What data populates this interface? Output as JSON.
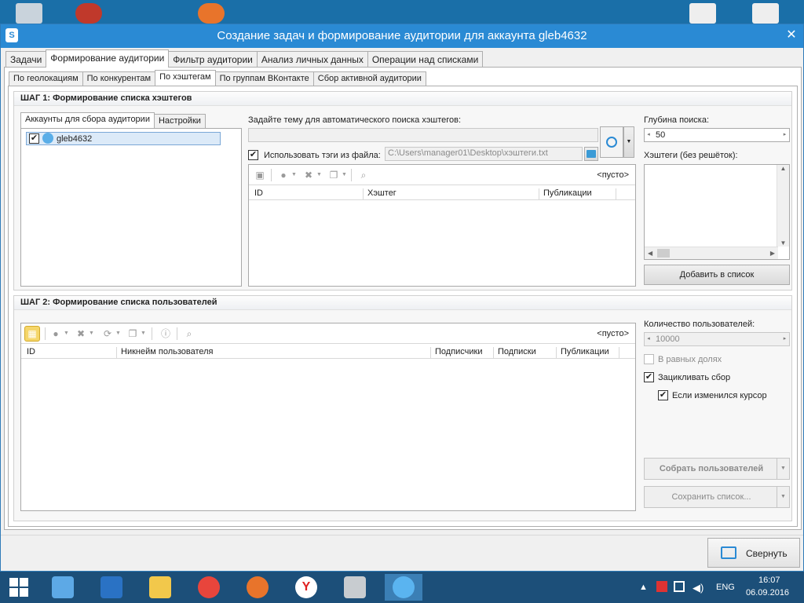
{
  "window": {
    "title": "Создание задач и формирование аудитории для аккаунта gleb4632",
    "close_glyph": "✕"
  },
  "main_tabs": [
    {
      "label": "Задачи"
    },
    {
      "label": "Формирование аудитории"
    },
    {
      "label": "Фильтр аудитории"
    },
    {
      "label": "Анализ личных данных"
    },
    {
      "label": "Операции над списками"
    }
  ],
  "sub_tabs": [
    {
      "label": "По геолокациям"
    },
    {
      "label": "По конкурентам"
    },
    {
      "label": "По хэштегам"
    },
    {
      "label": "По группам ВКонтакте"
    },
    {
      "label": "Сбор активной аудитории"
    }
  ],
  "step1": {
    "header": "ШАГ 1: Формирование списка хэштегов",
    "account_tabs": [
      {
        "label": "Аккаунты для сбора аудитории"
      },
      {
        "label": "Настройки"
      }
    ],
    "account": {
      "name": "gleb4632",
      "checked": true
    },
    "topic_label": "Задайте тему для автоматического поиска хэштегов:",
    "topic_value": "",
    "use_file_label": "Использовать тэги из файла:",
    "file_path": "C:\\Users\\manager01\\Desktop\\хэштеги.txt",
    "empty_text": "<пусто>",
    "columns": [
      "ID",
      "Хэштег",
      "Публикации"
    ],
    "depth_label": "Глубина поиска:",
    "depth_value": "50",
    "hashtags_label": "Хэштеги (без решёток):",
    "add_button": "Добавить в список"
  },
  "step2": {
    "header": "ШАГ 2: Формирование списка пользователей",
    "empty_text": "<пусто>",
    "columns": [
      "ID",
      "Никнейм пользователя",
      "Подписчики",
      "Подписки",
      "Публикации"
    ],
    "count_label": "Количество пользователей:",
    "count_value": "10000",
    "equal_shares": "В равных долях",
    "loop_collect": "Зацикливать сбор",
    "cursor_changed": "Если изменился курсор",
    "collect_button": "Собрать пользователей",
    "save_button": "Сохранить список..."
  },
  "footer": {
    "collapse_button": "Свернуть"
  },
  "taskbar": {
    "lang": "ENG",
    "time": "16:07",
    "date": "06.09.2016"
  },
  "colors": {
    "titlebar": "#2a8ad4",
    "taskbar": "#1c4f79",
    "desktop": "#1a6fa8"
  }
}
